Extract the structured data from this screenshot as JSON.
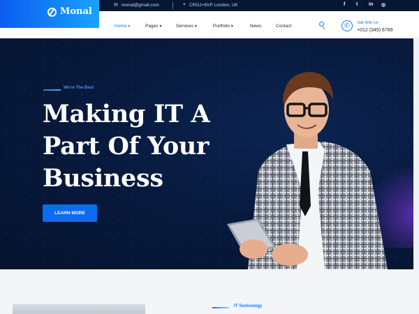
{
  "brand": {
    "name": "Monal"
  },
  "topbar": {
    "email": "monal@gmail.com",
    "address": "CRGJ+6VP London, UK",
    "social": [
      {
        "name": "facebook-icon",
        "glyph": "f"
      },
      {
        "name": "twitter-icon",
        "glyph": "t"
      },
      {
        "name": "linkedin-icon",
        "glyph": "in"
      },
      {
        "name": "instagram-icon",
        "glyph": "◎"
      }
    ]
  },
  "nav": {
    "items": [
      {
        "label": "Home",
        "active": true,
        "dropdown": true
      },
      {
        "label": "Pages",
        "active": false,
        "dropdown": true
      },
      {
        "label": "Services",
        "active": false,
        "dropdown": true
      },
      {
        "label": "Portfolio",
        "active": false,
        "dropdown": true
      },
      {
        "label": "News",
        "active": false,
        "dropdown": false
      },
      {
        "label": "Contact",
        "active": false,
        "dropdown": false
      }
    ],
    "talk_label": "Talk With Us",
    "phone": "+012 (345) 6789"
  },
  "hero": {
    "eyebrow": "We're The Best",
    "headline": "Making IT A Part Of Your Business",
    "button": "LEARN MORE"
  },
  "section2": {
    "label": "IT Technology"
  },
  "colors": {
    "accent": "#0a7cff",
    "hero_bg": "#071a3e",
    "topbar_bg": "#061633"
  }
}
